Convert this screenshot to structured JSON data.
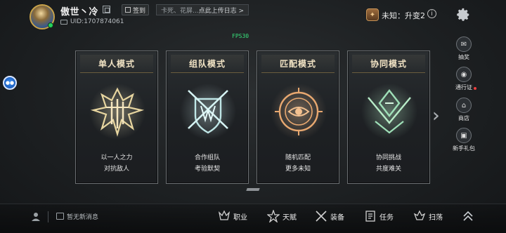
{
  "player": {
    "name": "傲世丶冷",
    "uid": "UID:1707874061",
    "checkin_label": "签到",
    "upload_banner": {
      "muted": "卡死、花屏...",
      "link": "点此上传日志 >"
    }
  },
  "rank": {
    "label": "未知：升变2",
    "info_glyph": "i"
  },
  "fps_label": "FPS30",
  "modes": [
    {
      "title": "单人模式",
      "line1": "以一人之力",
      "line2": "对抗敌人",
      "emblem_color": "#e8d6a0",
      "icon": "single-mode-emblem-icon"
    },
    {
      "title": "组队模式",
      "line1": "合作组队",
      "line2": "考验默契",
      "emblem_color": "#bfe6e6",
      "icon": "team-mode-emblem-icon"
    },
    {
      "title": "匹配模式",
      "line1": "随机匹配",
      "line2": "更多未知",
      "emblem_color": "#e8a870",
      "icon": "match-mode-emblem-icon"
    },
    {
      "title": "协同模式",
      "line1": "协同挑战",
      "line2": "共度难关",
      "emblem_color": "#9fe0b8",
      "icon": "coop-mode-emblem-icon"
    }
  ],
  "right_rail": [
    {
      "label": "抽奖",
      "icon": "lottery-icon"
    },
    {
      "label": "通行证",
      "icon": "pass-icon",
      "dot": true
    },
    {
      "label": "商店",
      "icon": "shop-icon"
    },
    {
      "label": "新手礼包",
      "icon": "gift-icon"
    }
  ],
  "messages": {
    "text": "暂无新消息"
  },
  "bottom_nav": [
    {
      "label": "职业",
      "icon": "class-icon"
    },
    {
      "label": "天赋",
      "icon": "talent-icon"
    },
    {
      "label": "装备",
      "icon": "equipment-icon"
    },
    {
      "label": "任务",
      "icon": "quest-icon"
    },
    {
      "label": "扫荡",
      "icon": "sweep-icon"
    }
  ],
  "colors": {
    "accent_gold": "#c9a34a",
    "fps_green": "#37e07a",
    "notify_red": "#f04040"
  }
}
